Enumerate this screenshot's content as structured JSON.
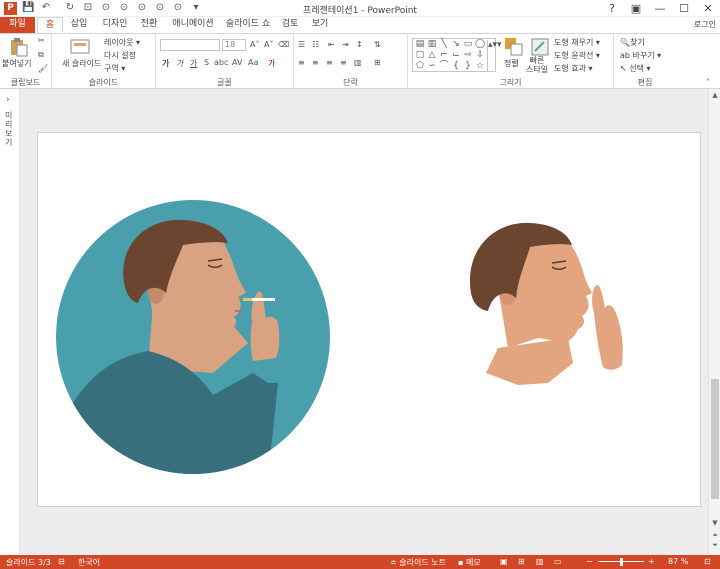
{
  "window": {
    "title": "프레젠테이션1 - PowerPoint",
    "app_icon": "P",
    "quick_access": [
      "save-icon",
      "undo-icon",
      "redo-icon",
      "start-from-beginning-icon"
    ],
    "controls": [
      "?",
      "▣",
      "—",
      "☐",
      "✕"
    ]
  },
  "tabs": {
    "file": "파일",
    "items": [
      "홈",
      "삽입",
      "디자인",
      "전환",
      "애니메이션",
      "슬라이드 쇼",
      "검토",
      "보기"
    ],
    "active": "홈",
    "signin": "로그인"
  },
  "ribbon": {
    "clipboard": {
      "label": "클립보드",
      "paste": "붙여넣기"
    },
    "slides": {
      "label": "슬라이드",
      "new_slide": "새 슬라이드",
      "layout": "레이아웃 ▾",
      "reset": "다시 설정",
      "section": "구역 ▾"
    },
    "font": {
      "label": "글꼴",
      "font_name": "",
      "font_size": "18",
      "bold": "가",
      "italic": "가",
      "underline": "가",
      "strike": "S",
      "shadow": "abc",
      "spacing": "AV",
      "case": "Aa",
      "color": "가"
    },
    "paragraph": {
      "label": "단락"
    },
    "drawing": {
      "label": "그리기",
      "arrange": "정렬",
      "quick_styles": "빠른\n스타일",
      "fill": "도형 채우기 ▾",
      "outline": "도형 윤곽선 ▾",
      "effects": "도형 효과 ▾"
    },
    "editing": {
      "label": "편집",
      "find": "찾기",
      "replace": "바꾸기 ▾",
      "select": "선택 ▾"
    }
  },
  "leftpanel": {
    "label": "미리보기"
  },
  "status": {
    "slide": "슬라이드 3/3",
    "language": "한국어",
    "notes": "슬라이드 노트",
    "comments": "메모",
    "zoom": "87 %"
  },
  "colors": {
    "accent": "#d24726",
    "circle": "#4a9fad",
    "shirt": "#386f7c",
    "skin_dark": "#d9a281",
    "skin_light": "#e3a580",
    "hair": "#6b4530"
  }
}
